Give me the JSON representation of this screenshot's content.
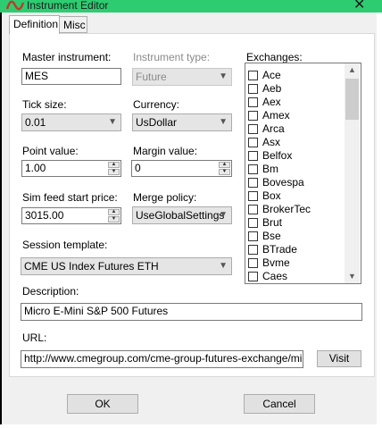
{
  "window": {
    "title": "Instrument Editor",
    "close_glyph": "✕",
    "title_icon": "instrument-logo-icon",
    "title_bar_color": "#2ecc71"
  },
  "tabs": [
    {
      "label": "Definition",
      "active": true
    },
    {
      "label": "Misc",
      "active": false
    }
  ],
  "form": {
    "master_instrument": {
      "label": "Master instrument:",
      "value": "MES"
    },
    "instrument_type": {
      "label": "Instrument type:",
      "value": "Future",
      "enabled": false
    },
    "tick_size": {
      "label": "Tick size:",
      "value": "0.01"
    },
    "currency": {
      "label": "Currency:",
      "value": "UsDollar"
    },
    "point_value": {
      "label": "Point value:",
      "value": "1.00"
    },
    "margin_value": {
      "label": "Margin value:",
      "value": "0"
    },
    "sim_feed_start_price": {
      "label": "Sim feed start price:",
      "value": "3015.00"
    },
    "merge_policy": {
      "label": "Merge policy:",
      "value": "UseGlobalSettings"
    },
    "session_template": {
      "label": "Session template:",
      "value": "CME US Index Futures ETH"
    },
    "description": {
      "label": "Description:",
      "value": "Micro E-Mini S&P 500 Futures"
    },
    "url": {
      "label": "URL:",
      "value": "http://www.cmegroup.com/cme-group-futures-exchange/micro-fu"
    },
    "visit_label": "Visit"
  },
  "exchanges": {
    "label": "Exchanges:",
    "items": [
      "Ace",
      "Aeb",
      "Aex",
      "Amex",
      "Arca",
      "Asx",
      "Belfox",
      "Bm",
      "Bovespa",
      "Box",
      "BrokerTec",
      "Brut",
      "Bse",
      "BTrade",
      "Bvme",
      "Caes"
    ]
  },
  "footer": {
    "ok_label": "OK",
    "cancel_label": "Cancel"
  }
}
